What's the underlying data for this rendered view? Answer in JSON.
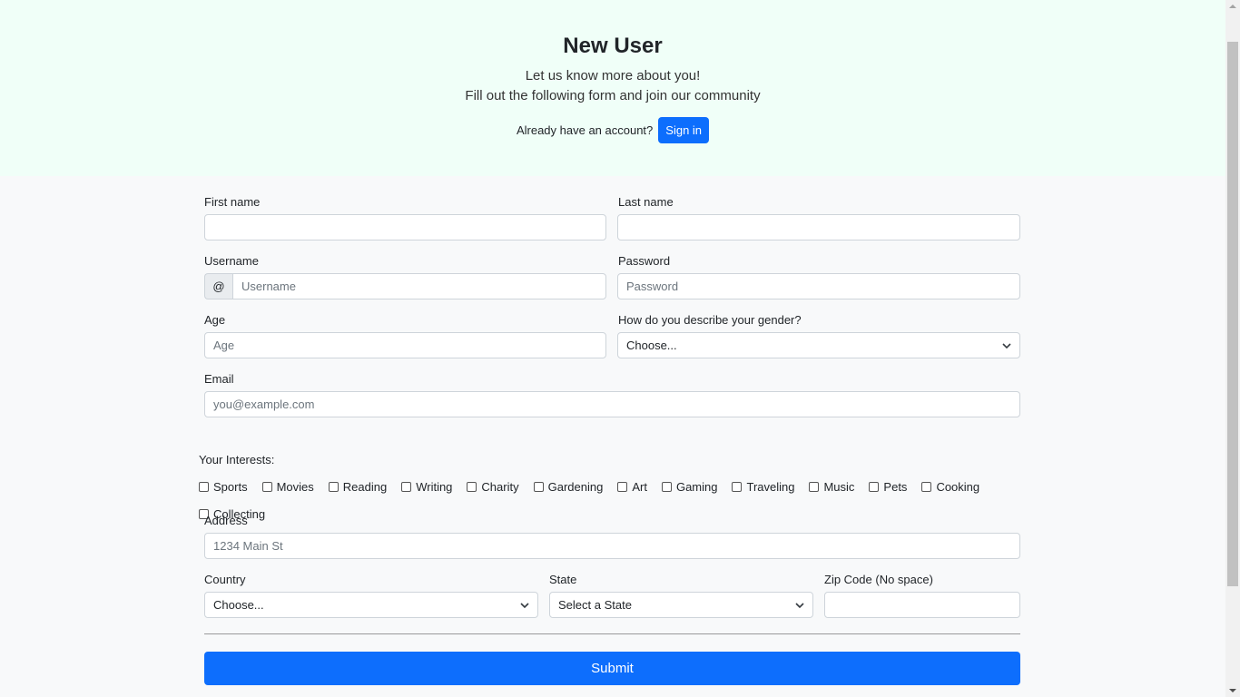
{
  "header": {
    "title": "New User",
    "subtitle_line1": "Let us know more about you!",
    "subtitle_line2": "Fill out the following form and join our community",
    "signin_prompt": "Already have an account?",
    "signin_label": "Sign in"
  },
  "form": {
    "first_name": {
      "label": "First name",
      "value": "",
      "placeholder": ""
    },
    "last_name": {
      "label": "Last name",
      "value": "",
      "placeholder": ""
    },
    "username": {
      "label": "Username",
      "prefix": "@",
      "placeholder": "Username"
    },
    "password": {
      "label": "Password",
      "placeholder": "Password"
    },
    "age": {
      "label": "Age",
      "placeholder": "Age"
    },
    "gender": {
      "label": "How do you describe your gender?",
      "selected": "Choose..."
    },
    "email": {
      "label": "Email",
      "placeholder": "you@example.com"
    },
    "interests": {
      "label": "Your Interests:",
      "options": [
        "Sports",
        "Movies",
        "Reading",
        "Writing",
        "Charity",
        "Gardening",
        "Art",
        "Gaming",
        "Traveling",
        "Music",
        "Pets",
        "Cooking",
        "Collecting"
      ]
    },
    "address": {
      "label": "Address",
      "placeholder": "1234 Main St"
    },
    "country": {
      "label": "Country",
      "selected": "Choose..."
    },
    "state": {
      "label": "State",
      "selected": "Select a State"
    },
    "zip": {
      "label": "Zip Code (No space)",
      "placeholder": ""
    },
    "submit_label": "Submit"
  },
  "icons": {
    "select_arrow": "chevron-down-icon",
    "checkbox": "checkbox-icon"
  },
  "colors": {
    "accent": "#0d6efd",
    "hero_bg": "#f0fff8",
    "page_bg": "#f8f9fa"
  }
}
